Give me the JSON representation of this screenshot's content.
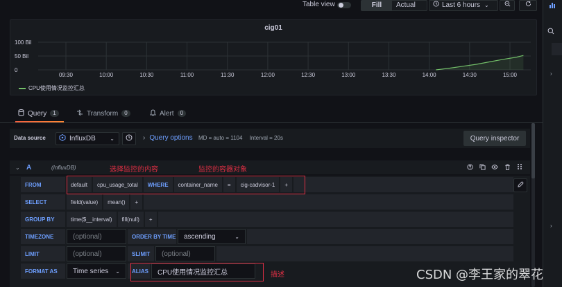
{
  "toolbar": {
    "table_view_label": "Table view",
    "fill_label": "Fill",
    "actual_label": "Actual",
    "time_range_label": "Last 6 hours"
  },
  "panel": {
    "title": "cig01",
    "legend": "CPU使用情况监控汇总"
  },
  "chart_data": {
    "type": "line",
    "title": "cig01",
    "xlabel": "",
    "ylabel": "",
    "x_ticks": [
      "09:30",
      "10:00",
      "10:30",
      "11:00",
      "11:30",
      "12:00",
      "12:30",
      "13:00",
      "13:30",
      "14:00",
      "14:30",
      "15:00"
    ],
    "y_ticks": [
      "100 Bil",
      "50 Bil",
      "0"
    ],
    "ylim": [
      0,
      100
    ],
    "series": [
      {
        "name": "CPU使用情况监控汇总",
        "color": "#73bf69",
        "x": [
          "14:05",
          "14:15",
          "14:25",
          "14:35",
          "14:45",
          "14:55",
          "15:05",
          "15:10"
        ],
        "values": [
          0,
          6,
          13,
          20,
          29,
          38,
          46,
          52
        ]
      }
    ],
    "grid": true,
    "legend_position": "bottom-left"
  },
  "tabs": [
    {
      "label": "Query",
      "count": "1"
    },
    {
      "label": "Transform",
      "count": "0"
    },
    {
      "label": "Alert",
      "count": "0"
    }
  ],
  "datasource": {
    "label": "Data source",
    "selected": "InfluxDB",
    "query_options_label": "Query options",
    "meta_md": "MD = auto = 1104",
    "meta_interval": "Interval = 20s",
    "inspector_label": "Query inspector"
  },
  "query": {
    "letter": "A",
    "datasource_name": "(InfluxDB)",
    "annotation_select": "选择监控的内容",
    "annotation_container": "监控的容器对象",
    "annotation_alias": "描述",
    "from_kw": "FROM",
    "from_policy": "default",
    "from_measurement": "cpu_usage_total",
    "where_kw": "WHERE",
    "where_key": "container_name",
    "where_op": "=",
    "where_value": "cig-cadvisor-1",
    "plus": "+",
    "select_kw": "SELECT",
    "select_field": "field(value)",
    "select_fn": "mean()",
    "groupby_kw": "GROUP BY",
    "groupby_time": "time($__interval)",
    "groupby_fill": "fill(null)",
    "timezone_kw": "TIMEZONE",
    "timezone_placeholder": "(optional)",
    "orderby_kw": "ORDER BY TIME",
    "orderby_value": "ascending",
    "limit_kw": "LIMIT",
    "limit_placeholder": "(optional)",
    "slimit_kw": "SLIMIT",
    "slimit_placeholder": "(optional)",
    "format_kw": "FORMAT AS",
    "format_value": "Time series",
    "alias_kw": "ALIAS",
    "alias_value": "CPU使用情况监控汇总"
  },
  "watermark": "CSDN @李王家的翠花"
}
